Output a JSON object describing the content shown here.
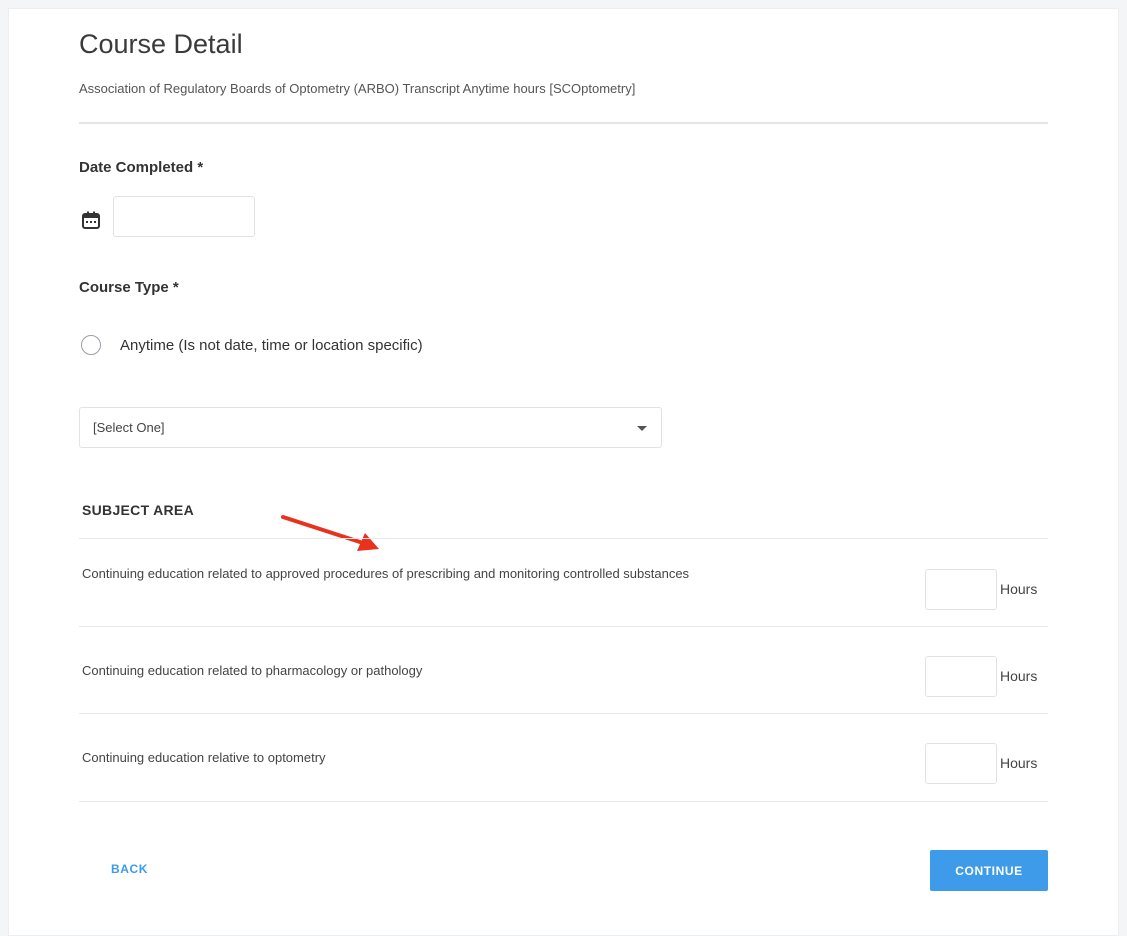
{
  "page": {
    "title": "Course Detail",
    "subtitle": "Association of Regulatory Boards of Optometry (ARBO) Transcript Anytime hours [SCOptometry]"
  },
  "date_completed": {
    "label": "Date Completed *",
    "value": "",
    "icon": "calendar-icon"
  },
  "course_type": {
    "label": "Course Type *",
    "option_label": "Anytime (Is not date, time or location specific)",
    "selected": false,
    "select_value": "[Select One]"
  },
  "subject_area": {
    "heading": "SUBJECT AREA",
    "rows": [
      {
        "text": "Continuing education related to approved procedures of prescribing and monitoring controlled substances",
        "hours_value": "",
        "hours_label": "Hours"
      },
      {
        "text": "Continuing education related to pharmacology or pathology",
        "hours_value": "",
        "hours_label": "Hours"
      },
      {
        "text": "Continuing education relative to optometry",
        "hours_value": "",
        "hours_label": "Hours"
      }
    ]
  },
  "actions": {
    "back_label": "BACK",
    "continue_label": "CONTINUE"
  },
  "colors": {
    "accent": "#3d9be9",
    "annotation_arrow": "#e8321e"
  }
}
